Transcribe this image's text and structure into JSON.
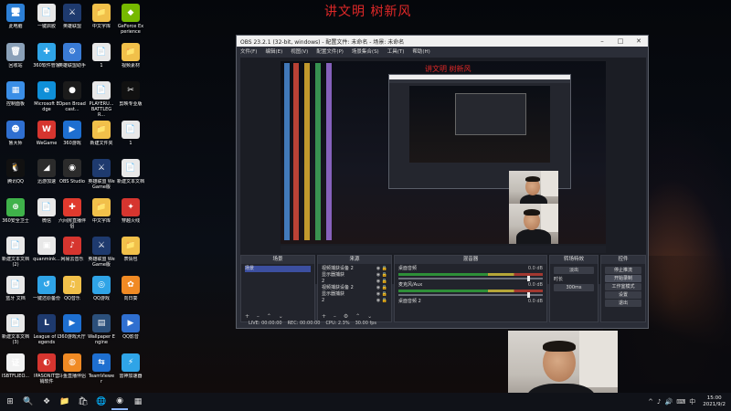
{
  "overlay_title": "讲文明 树新风",
  "desktop_icons": [
    {
      "label": "此电脑",
      "color": "#2c7fd6",
      "glyph": "🖥"
    },
    {
      "label": "一键启胶",
      "color": "#e8e8e8",
      "glyph": "📄"
    },
    {
      "label": "英雄联盟",
      "color": "#1e3a6e",
      "glyph": "⚔"
    },
    {
      "label": "中文字库",
      "color": "#f1c04a",
      "glyph": "📁"
    },
    {
      "label": "GeForce Experience",
      "color": "#76b900",
      "glyph": "◆"
    },
    {
      "label": "回收站",
      "color": "#8aa0b8",
      "glyph": "🗑"
    },
    {
      "label": "360软件管家",
      "color": "#2fa4e7",
      "glyph": "✚"
    },
    {
      "label": "英雄联盟助手",
      "color": "#3a7bd5",
      "glyph": "⚙"
    },
    {
      "label": "1",
      "color": "#e8e8e8",
      "glyph": "📄"
    },
    {
      "label": "视频素材",
      "color": "#f1c04a",
      "glyph": "📁"
    },
    {
      "label": "控制面板",
      "color": "#3a8ee6",
      "glyph": "▦"
    },
    {
      "label": "Microsoft Edge",
      "color": "#0f8fd8",
      "glyph": "e"
    },
    {
      "label": "Open Broadcast...",
      "color": "#1b1b1b",
      "glyph": "●"
    },
    {
      "label": "PLAYERU... BATTLEGR...",
      "color": "#e8e8e8",
      "glyph": "📄"
    },
    {
      "label": "剪映专业版",
      "color": "#111111",
      "glyph": "✂"
    },
    {
      "label": "鲁大师",
      "color": "#2f6fd0",
      "glyph": "☻"
    },
    {
      "label": "WeGame",
      "color": "#d6352f",
      "glyph": "W"
    },
    {
      "label": "360游戏",
      "color": "#1e6fd0",
      "glyph": "▶"
    },
    {
      "label": "新建文件夹",
      "color": "#f1c04a",
      "glyph": "📁"
    },
    {
      "label": "1",
      "color": "#e8e8e8",
      "glyph": "📄"
    },
    {
      "label": "腾讯QQ",
      "color": "#111111",
      "glyph": "🐧"
    },
    {
      "label": "迅游加速",
      "color": "#2b2b2b",
      "glyph": "◢"
    },
    {
      "label": "OBS Studio",
      "color": "#2b2b2b",
      "glyph": "◉"
    },
    {
      "label": "英雄联盟 WeGame版",
      "color": "#1e3a6e",
      "glyph": "⚔"
    },
    {
      "label": "新建文本文档",
      "color": "#e8e8e8",
      "glyph": "📄"
    },
    {
      "label": "360安全卫士",
      "color": "#3fb24a",
      "glyph": "⊕"
    },
    {
      "label": "微信",
      "color": "#e8e8e8",
      "glyph": "📄"
    },
    {
      "label": "六间房直播伴侣",
      "color": "#e03a2e",
      "glyph": "✚"
    },
    {
      "label": "中文字库",
      "color": "#f1c04a",
      "glyph": "📁"
    },
    {
      "label": "穿越火线",
      "color": "#d6352f",
      "glyph": "✦"
    },
    {
      "label": "新建文本文档 (2)",
      "color": "#e8e8e8",
      "glyph": "📄"
    },
    {
      "label": "quanmink...",
      "color": "#e8e8e8",
      "glyph": "▣"
    },
    {
      "label": "网易云音乐",
      "color": "#d6352f",
      "glyph": "♪"
    },
    {
      "label": "英雄联盟 WeGame版",
      "color": "#1e3a6e",
      "glyph": "⚔"
    },
    {
      "label": "表情包",
      "color": "#f1c04a",
      "glyph": "📁"
    },
    {
      "label": "蓝牙 文档",
      "color": "#e8e8e8",
      "glyph": "📄"
    },
    {
      "label": "一键还原备份",
      "color": "#2fa4e7",
      "glyph": "↺"
    },
    {
      "label": "QQ音乐",
      "color": "#f1c04a",
      "glyph": "♫"
    },
    {
      "label": "QQ游戏",
      "color": "#2fa4e7",
      "glyph": "◎"
    },
    {
      "label": "向日葵",
      "color": "#f08a24",
      "glyph": "✿"
    },
    {
      "label": "新建文本文档 (3)",
      "color": "#e8e8e8",
      "glyph": "📄"
    },
    {
      "label": "League of Legends",
      "color": "#1e3a6e",
      "glyph": "L"
    },
    {
      "label": "360游戏大厅",
      "color": "#1e6fd0",
      "glyph": "▶"
    },
    {
      "label": "Wallpaper Engine",
      "color": "#2b4f7a",
      "glyph": "▤"
    },
    {
      "label": "QQ影音",
      "color": "#2f6fd0",
      "glyph": "▶"
    },
    {
      "label": "ISBTFLIEO...",
      "color": "#f2f2f2",
      "glyph": "证"
    },
    {
      "label": "IPASONIT营销软件",
      "color": "#d6352f",
      "glyph": "◐"
    },
    {
      "label": "斗鱼直播伴侣",
      "color": "#f08a24",
      "glyph": "◍"
    },
    {
      "label": "TeamViewer",
      "color": "#1e6fd0",
      "glyph": "⇆"
    },
    {
      "label": "雷神加速器",
      "color": "#2fa4e7",
      "glyph": "⚡"
    }
  ],
  "obs": {
    "title": "OBS 23.2.1 (32-bit, windows) - 配置文件: 未命名 - 场景: 未命名",
    "window_controls": [
      "–",
      "□",
      "✕"
    ],
    "menu": [
      "文件(F)",
      "编辑(E)",
      "视图(V)",
      "配置文件(P)",
      "场景集合(S)",
      "工具(T)",
      "帮助(H)"
    ],
    "preview_title": "讲文明 树新风",
    "docks": {
      "scenes": {
        "title": "场景",
        "items": [
          "场景"
        ]
      },
      "sources": {
        "title": "来源",
        "items": [
          "视频捕获设备 2",
          "显示器捕获",
          "2",
          "视频捕获设备 2",
          "显示器捕获",
          "2"
        ]
      },
      "mixer": {
        "title": "混音器",
        "tracks": [
          {
            "name": "桌面音频",
            "db": "0.0 dB"
          },
          {
            "name": "麦克风/Aux",
            "db": "0.0 dB"
          },
          {
            "name": "桌面音频 2",
            "db": "0.0 dB"
          }
        ]
      },
      "transitions": {
        "title": "转场特效",
        "mode": "淡出",
        "duration_label": "时长",
        "duration": "300ms"
      },
      "controls": {
        "title": "控件",
        "buttons": [
          "停止推流",
          "开始录制",
          "工作室模式",
          "设置",
          "退出"
        ]
      }
    },
    "statusbar": [
      "LIVE: 00:00:00",
      "REC: 00:00:00",
      "CPU: 2.3%",
      "30.00 fps"
    ]
  },
  "taskbar": {
    "items": [
      "⊞",
      "🔍",
      "❖",
      "📁",
      "🛍",
      "🌐",
      "◉",
      "▦"
    ],
    "tray": [
      "^",
      "♪",
      "🔊",
      "⌨",
      "中"
    ],
    "time": "15:00",
    "date": "2021/9/2"
  }
}
